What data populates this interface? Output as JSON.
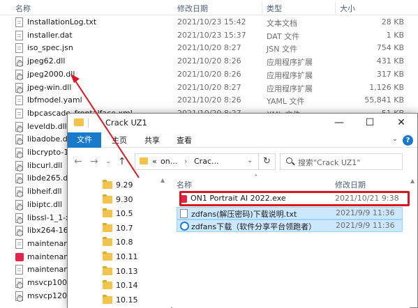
{
  "background": {
    "columns": {
      "name": "名称",
      "date": "修改日期",
      "type": "类型",
      "size": "大小"
    },
    "files": [
      {
        "name": "InstallationLog.txt",
        "date": "2021/10/23 15:42",
        "type": "文本文档",
        "size": "28 KB",
        "icon": "doc"
      },
      {
        "name": "installer.dat",
        "date": "2021/10/23 15:37",
        "type": "DAT 文件",
        "size": "1 KB",
        "icon": "doc"
      },
      {
        "name": "iso_spec.jsn",
        "date": "2021/10/20 8:27",
        "type": "JSN 文件",
        "size": "754 KB",
        "icon": "doc"
      },
      {
        "name": "jpeg62.dll",
        "date": "2021/10/20 8:26",
        "type": "应用程序扩展",
        "size": "431 KB",
        "icon": "gear"
      },
      {
        "name": "jpeg2000.dll",
        "date": "2021/10/20 8:26",
        "type": "应用程序扩展",
        "size": "317 KB",
        "icon": "gear"
      },
      {
        "name": "jpeg-win.dll",
        "date": "2021/10/20 8:27",
        "type": "应用程序扩展",
        "size": "1,126 KB",
        "icon": "gear"
      },
      {
        "name": "lbfmodel.yaml",
        "date": "2021/10/20 8:26",
        "type": "YAML 文件",
        "size": "55,841 KB",
        "icon": "doc"
      },
      {
        "name": "lbpcascade_frontalface.xml",
        "date": "2021/10/20 8:27",
        "type": "XML 文件",
        "size": "51 KB",
        "icon": "doc"
      },
      {
        "name": "leveldb.dll",
        "date": "",
        "type": "",
        "size": "",
        "icon": "gear"
      },
      {
        "name": "libadobe.dll",
        "date": "",
        "type": "",
        "size": "",
        "icon": "gear"
      },
      {
        "name": "libcrypto-1",
        "date": "",
        "type": "",
        "size": "",
        "icon": "gear"
      },
      {
        "name": "libcurl.dll",
        "date": "",
        "type": "",
        "size": "",
        "icon": "gear"
      },
      {
        "name": "libde265.dl",
        "date": "",
        "type": "",
        "size": "",
        "icon": "gear"
      },
      {
        "name": "libheif.dll",
        "date": "",
        "type": "",
        "size": "",
        "icon": "gear"
      },
      {
        "name": "libiptc.dll",
        "date": "",
        "type": "",
        "size": "",
        "icon": "gear"
      },
      {
        "name": "libssl-1_1-x",
        "date": "",
        "type": "",
        "size": "",
        "icon": "gear"
      },
      {
        "name": "libx264-16",
        "date": "",
        "type": "",
        "size": "",
        "icon": "gear"
      },
      {
        "name": "maintenan",
        "date": "",
        "type": "",
        "size": "",
        "icon": "doc"
      },
      {
        "name": "maintenan",
        "date": "",
        "type": "",
        "size": "",
        "icon": "red"
      },
      {
        "name": "maintenan",
        "date": "",
        "type": "",
        "size": "",
        "icon": "doc"
      },
      {
        "name": "msvcp100.",
        "date": "",
        "type": "",
        "size": "",
        "icon": "gear"
      },
      {
        "name": "msvcp120.",
        "date": "",
        "type": "",
        "size": "",
        "icon": "gear"
      }
    ]
  },
  "window": {
    "title": "Crack UZ1",
    "min": "—",
    "max": "☐",
    "close": "✕",
    "ribbon": {
      "file": "文件",
      "home": "主页",
      "share": "共享",
      "view": "查看",
      "help": "?",
      "expand": "⌄"
    },
    "nav": {
      "back": "←",
      "forward": "→",
      "dropdown": "⌄",
      "up": "↑"
    },
    "address": {
      "overflow": "«",
      "part1": "on...",
      "sep": "›",
      "part2": "Crac...",
      "dropdown": "⌄"
    },
    "refresh": "↻",
    "search_placeholder": "搜索\"Crack UZ1\"",
    "folders": [
      "9.29",
      "9.30",
      "10.5",
      "10.7",
      "10.8",
      "10.11",
      "10.13",
      "10.14",
      "10.15"
    ],
    "columns": {
      "name": "名称",
      "date": "修改日期"
    },
    "files": [
      {
        "name": "ON1 Portrait AI 2022.exe",
        "date": "2021/10/21 9:38",
        "icon": "exe"
      },
      {
        "name": "zdfans(解压密码)下载说明.txt",
        "date": "2021/9/9 11:36",
        "icon": "txt"
      },
      {
        "name": "zdfans下载（软件分享平台领跑者）",
        "date": "2021/9/9 11:36",
        "icon": "web"
      }
    ]
  },
  "colors": {
    "accent": "#1979ca",
    "highlight": "#d9161f",
    "selection": "#cce8ff"
  }
}
